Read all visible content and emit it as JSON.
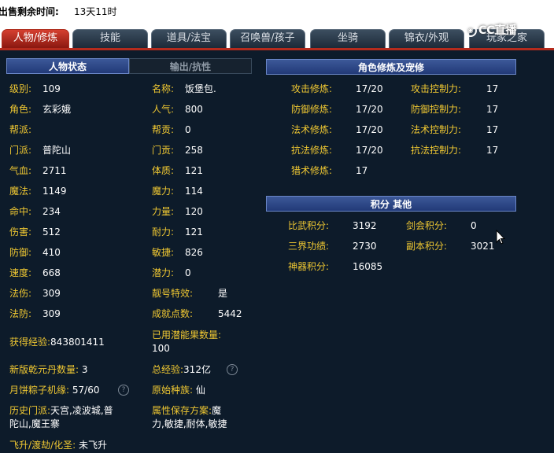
{
  "top_bar": {
    "label": "出售剩余时间:",
    "value": "13天11时"
  },
  "tabs": [
    "人物/修炼",
    "技能",
    "道具/法宝",
    "召唤兽/孩子",
    "坐骑",
    "锦衣/外观",
    "玩家之家"
  ],
  "active_tab": "人物/修炼",
  "logo": {
    "text": "CC直播"
  },
  "left_panel": {
    "tab_active": "人物状态",
    "tab_inactive": "输出/抗性",
    "stats_left": [
      {
        "k": "级别:",
        "v": "109"
      },
      {
        "k": "角色:",
        "v": "玄彩娥"
      },
      {
        "k": "帮派:",
        "v": ""
      },
      {
        "k": "门派:",
        "v": "普陀山"
      },
      {
        "k": "气血:",
        "v": "2711"
      },
      {
        "k": "魔法:",
        "v": "1149"
      },
      {
        "k": "命中:",
        "v": "234"
      },
      {
        "k": "伤害:",
        "v": "512"
      },
      {
        "k": "防御:",
        "v": "410"
      },
      {
        "k": "速度:",
        "v": "668"
      },
      {
        "k": "法伤:",
        "v": "309"
      },
      {
        "k": "法防:",
        "v": "309"
      }
    ],
    "stats_right": [
      {
        "k": "名称:",
        "v": "饭堡包."
      },
      {
        "k": "人气:",
        "v": "800"
      },
      {
        "k": "帮贡:",
        "v": "0"
      },
      {
        "k": "门贡:",
        "v": "258"
      },
      {
        "k": "体质:",
        "v": "121"
      },
      {
        "k": "魔力:",
        "v": "114"
      },
      {
        "k": "力量:",
        "v": "120"
      },
      {
        "k": "耐力:",
        "v": "121"
      },
      {
        "k": "敏捷:",
        "v": "826"
      },
      {
        "k": "潜力:",
        "v": "0"
      },
      {
        "k": "靓号特效:",
        "v": "是"
      },
      {
        "k": "成就点数:",
        "v": "5442"
      }
    ],
    "exp": {
      "k": "获得经验:",
      "v": "843801411"
    },
    "potential_fruit": {
      "k": "已用潜能果数量:",
      "v": "100"
    },
    "qianyuan": {
      "k": "新版乾元丹数量:",
      "v": "3"
    },
    "total_exp": {
      "k": "总经验:",
      "v": "312亿"
    },
    "mooncake": {
      "k": "月饼粽子机缘:",
      "v": "57/60"
    },
    "race": {
      "k": "原始种族:",
      "v": "仙"
    },
    "history_k": "历史门派:",
    "history_v1": "天宫,凌波城,普",
    "history_v2": "陀山,魔王寨",
    "attr_k": "属性保存方案:",
    "attr_v1": "魔",
    "attr_v2": "力,敏捷,耐体,敏捷",
    "fly": {
      "k": "飞升/渡劫/化圣:",
      "v": "未飞升"
    },
    "help_glyph": "?"
  },
  "cultivation": {
    "title": "角色修炼及宠修",
    "rows": [
      {
        "k1": "攻击修炼:",
        "v1": "17/20",
        "k2": "攻击控制力:",
        "v2": "17"
      },
      {
        "k1": "防御修炼:",
        "v1": "17/20",
        "k2": "防御控制力:",
        "v2": "17"
      },
      {
        "k1": "法术修炼:",
        "v1": "17/20",
        "k2": "法术控制力:",
        "v2": "17"
      },
      {
        "k1": "抗法修炼:",
        "v1": "17/20",
        "k2": "抗法控制力:",
        "v2": "17"
      }
    ],
    "hunt": {
      "k": "猎术修炼:",
      "v": "17"
    }
  },
  "points": {
    "title": "积分 其他",
    "rows": [
      {
        "k1": "比武积分:",
        "v1": "3192",
        "k2": "剑会积分:",
        "v2": "0"
      },
      {
        "k1": "三界功绩:",
        "v1": "2730",
        "k2": "副本积分:",
        "v2": "3021"
      }
    ],
    "artifact": {
      "k": "神器积分:",
      "v": "16085"
    }
  }
}
